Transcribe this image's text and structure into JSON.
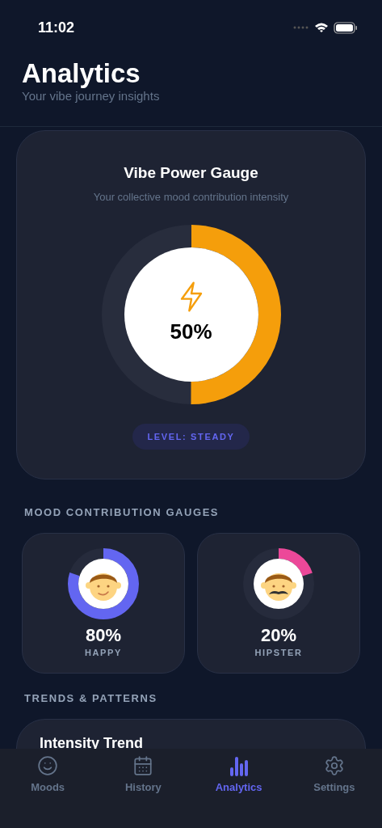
{
  "status_bar": {
    "time": "11:02"
  },
  "header": {
    "title": "Analytics",
    "subtitle": "Your vibe journey insights"
  },
  "vibe_gauge": {
    "title": "Vibe Power Gauge",
    "subtitle": "Your collective mood contribution intensity",
    "level": 0.5,
    "reading": "50%",
    "badge": "LEVEL: STEADY"
  },
  "mood_section": {
    "heading": "MOOD CONTRIBUTION GAUGES",
    "moods": [
      {
        "kind": "happy",
        "label": "HAPPY",
        "reading": "80%",
        "level": 0.8,
        "color": "#6366f1"
      },
      {
        "kind": "hipster",
        "label": "HIPSTER",
        "reading": "20%",
        "level": 0.2,
        "color": "#ec4899"
      }
    ]
  },
  "trends_section": {
    "heading": "TRENDS & PATTERNS",
    "card_title": "Intensity Trend"
  },
  "tab_bar": [
    {
      "kind": "moods",
      "label": "Moods",
      "selected": false
    },
    {
      "kind": "history",
      "label": "History",
      "selected": false
    },
    {
      "kind": "analytics",
      "label": "Analytics",
      "selected": true
    },
    {
      "kind": "settings",
      "label": "Settings",
      "selected": false
    }
  ]
}
